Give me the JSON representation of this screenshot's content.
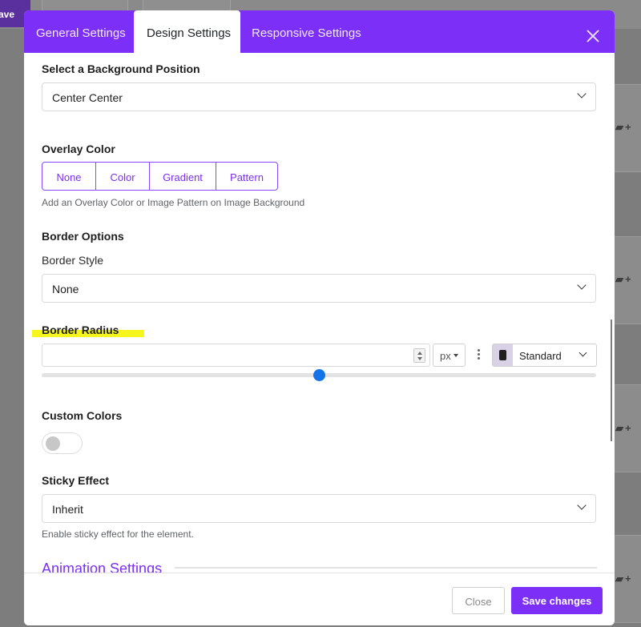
{
  "background": {
    "save_label": "ave"
  },
  "tabs": [
    {
      "label": "General Settings",
      "active": false
    },
    {
      "label": "Design Settings",
      "active": true
    },
    {
      "label": "Responsive Settings",
      "active": false
    }
  ],
  "background_position": {
    "label": "Select a Background Position",
    "value": "Center Center"
  },
  "overlay": {
    "label": "Overlay Color",
    "options": [
      "None",
      "Color",
      "Gradient",
      "Pattern"
    ],
    "help": "Add an Overlay Color or Image Pattern on Image Background"
  },
  "border": {
    "options_label": "Border Options",
    "style_label": "Border Style",
    "style_value": "None",
    "radius_label": "Border Radius",
    "radius_value": "",
    "unit": "px",
    "device": "Standard",
    "slider_fraction": 0.5
  },
  "custom_colors": {
    "label": "Custom Colors",
    "enabled": false
  },
  "sticky": {
    "label": "Sticky Effect",
    "value": "Inherit",
    "help": "Enable sticky effect for the element."
  },
  "animation": {
    "title": "Animation Settings"
  },
  "footer": {
    "close_label": "Close",
    "save_label": "Save changes"
  },
  "colors": {
    "accent": "#7b2ff7",
    "slider": "#1473e6",
    "highlight": "#f7f51e"
  }
}
